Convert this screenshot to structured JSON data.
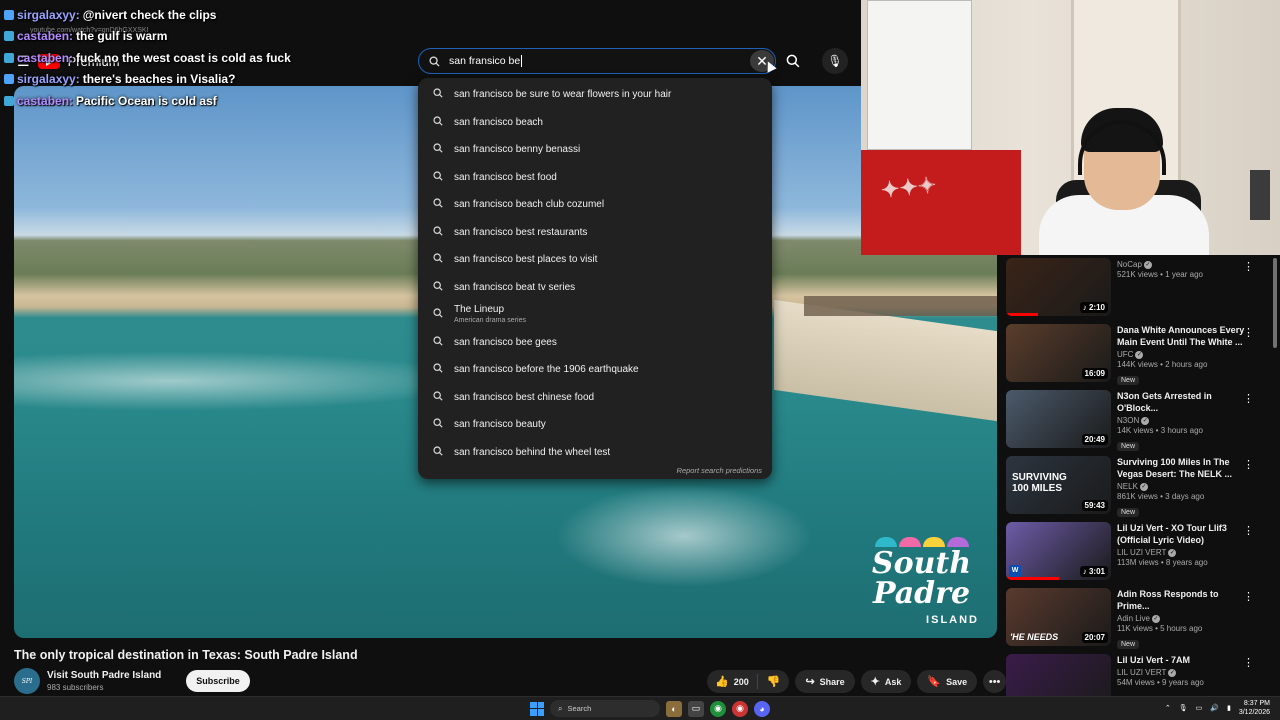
{
  "browser": {
    "url_ghost": "youtube.com/watch?v=gnD6hGXXSKI"
  },
  "header": {
    "brand": "Premium"
  },
  "chat": [
    {
      "user": "sirgalaxyy:",
      "message": "@nivert check the clips",
      "badge_color": "#4fa3ff",
      "user_class": "u-sirg"
    },
    {
      "user": "castaben:",
      "message": "the gulf is warm",
      "badge_color": "#3fa8d8",
      "user_class": "u-cast"
    },
    {
      "user": "castaben:",
      "message": "fuck no the west coast is cold as fuck",
      "badge_color": "#3fa8d8",
      "user_class": "u-cast"
    },
    {
      "user": "sirgalaxyy:",
      "message": "there's beaches in Visalia?",
      "badge_color": "#4fa3ff",
      "user_class": "u-sirg"
    },
    {
      "user": "castaben:",
      "message": "Pacific Ocean is cold asf",
      "badge_color": "#3fa8d8",
      "user_class": "u-cast"
    }
  ],
  "search": {
    "query": "san fransico be",
    "suggestions": [
      {
        "text": "san francisco be sure to wear flowers in your hair"
      },
      {
        "text": "san francisco beach"
      },
      {
        "text": "san francisco benny benassi"
      },
      {
        "text": "san francisco best food"
      },
      {
        "text": "san francisco beach club cozumel"
      },
      {
        "text": "san francisco best restaurants"
      },
      {
        "text": "san francisco best places to visit"
      },
      {
        "text": "san francisco beat tv series"
      },
      {
        "text": "The Lineup",
        "sub": "American drama series"
      },
      {
        "text": "san francisco bee gees"
      },
      {
        "text": "san francisco before the 1906 earthquake"
      },
      {
        "text": "san francisco best chinese food"
      },
      {
        "text": "san francisco beauty"
      },
      {
        "text": "san francisco behind the wheel test"
      }
    ],
    "report_label": "Report search predictions"
  },
  "player": {
    "logo_main": "South Padre",
    "logo_sub": "ISLAND",
    "umbrella_colors": [
      "#2fb8c9",
      "#f06aa8",
      "#f7d23a",
      "#b46ad8"
    ]
  },
  "video": {
    "title": "The only tropical destination in Texas: South Padre Island",
    "channel": "Visit South Padre Island",
    "subscribers": "983 subscribers",
    "subscribe_label": "Subscribe",
    "likes": "200",
    "share_label": "Share",
    "ask_label": "Ask",
    "save_label": "Save"
  },
  "recommendations": [
    {
      "title": "",
      "channel": "NoCap",
      "meta": "521K views • 1 year ago",
      "duration": "2:10",
      "new": "",
      "thumb": "#3a2418",
      "progress": 0.3,
      "music": true,
      "wm": false
    },
    {
      "title": "Dana White Announces Every Main Event Until The White ...",
      "channel": "UFC",
      "meta": "144K views • 2 hours ago",
      "duration": "16:09",
      "new": "New",
      "thumb": "#5a3d2b",
      "progress": 0,
      "music": false,
      "wm": false
    },
    {
      "title": "N3on Gets Arrested in O'Block...",
      "channel": "N3ON",
      "meta": "14K views • 3 hours ago",
      "duration": "20:49",
      "new": "New",
      "thumb": "#4b5a6b",
      "progress": 0,
      "music": false,
      "wm": false
    },
    {
      "title": "Surviving 100 Miles In The Vegas Desert: The NELK ...",
      "channel": "NELK",
      "meta": "861K views • 3 days ago",
      "duration": "59:43",
      "new": "New",
      "thumb": "#2c3540",
      "progress": 0,
      "music": false,
      "wm": false
    },
    {
      "title": "Lil Uzi Vert - XO Tour Llif3 (Official Lyric Video)",
      "channel": "LIL UZI VERT",
      "meta": "113M views • 8 years ago",
      "duration": "3:01",
      "new": "",
      "thumb": "#6d5ca8",
      "progress": 0.5,
      "music": true,
      "wm": true
    },
    {
      "title": "Adin Ross Responds to Prime...",
      "channel": "Adin Live",
      "meta": "11K views • 5 hours ago",
      "duration": "20:07",
      "new": "New",
      "thumb": "#5a3a2e",
      "progress": 0,
      "music": false,
      "wm": false
    },
    {
      "title": "Lil Uzi Vert - 7AM",
      "channel": "LIL UZI VERT",
      "meta": "54M views • 9 years ago",
      "duration": "3:40",
      "new": "",
      "thumb": "#3a1c4a",
      "progress": 0.4,
      "music": true,
      "wm": true
    }
  ],
  "thumb_text": {
    "surviving": "SURVIVING 100 MILES",
    "needs": "'HE NEEDS"
  },
  "taskbar": {
    "search_label": "Search",
    "time": "8:37 PM",
    "date": "3/12/2026"
  }
}
